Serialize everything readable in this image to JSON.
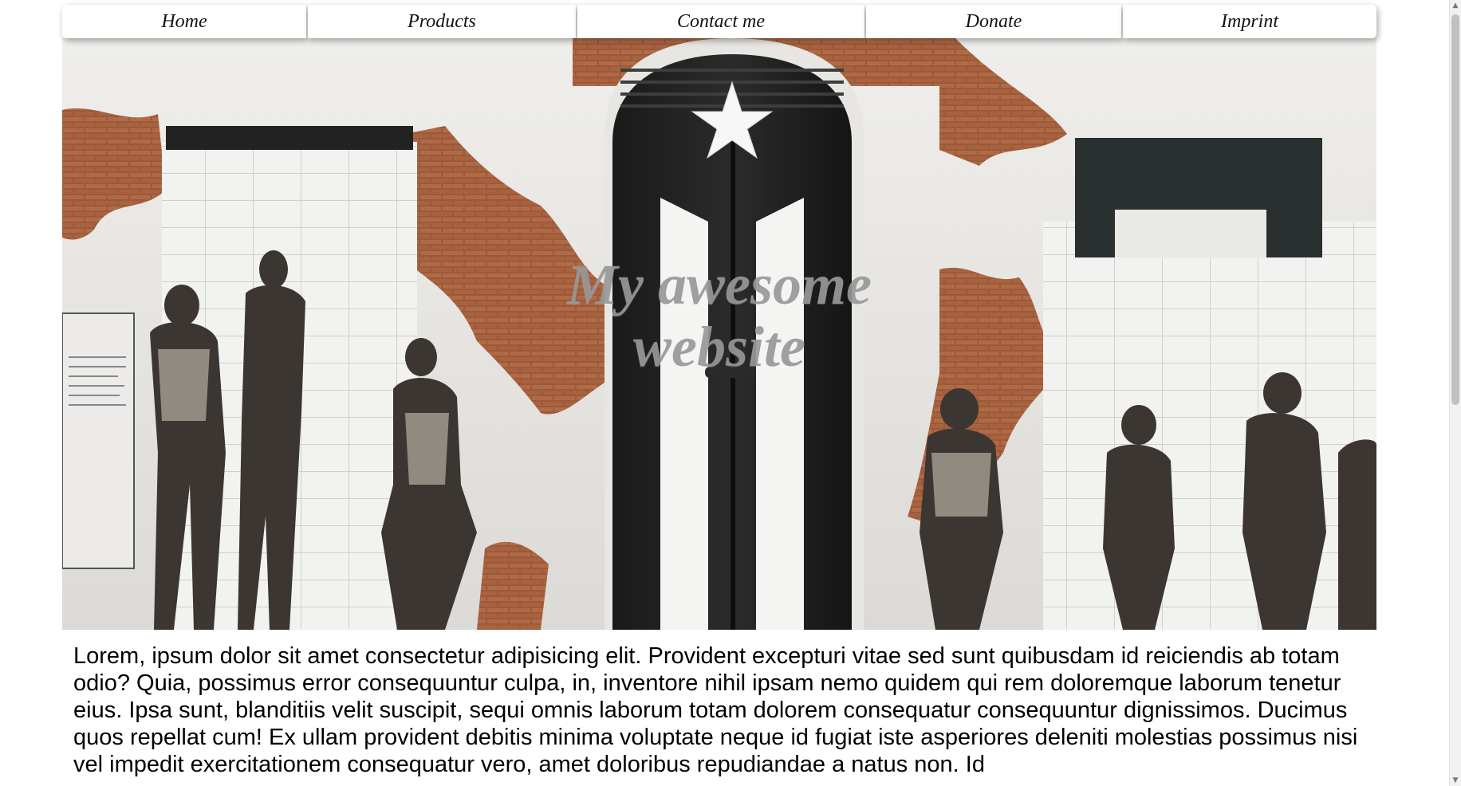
{
  "nav": {
    "items": [
      {
        "label": "Home"
      },
      {
        "label": "Products"
      },
      {
        "label": "Contact me"
      },
      {
        "label": "Donate"
      },
      {
        "label": "Imprint"
      }
    ]
  },
  "hero": {
    "title_line1": "My awesome",
    "title_line2": "website",
    "image_description_icon": "street-art-wall-image"
  },
  "content": {
    "paragraph": "Lorem, ipsum dolor sit amet consectetur adipisicing elit. Provident excepturi vitae sed sunt quibusdam id reiciendis ab totam odio? Quia, possimus error consequuntur culpa, in, inventore nihil ipsam nemo quidem qui rem doloremque laborum tenetur eius. Ipsa sunt, blanditiis velit suscipit, sequi omnis laborum totam dolorem consequatur consequuntur dignissimos. Ducimus quos repellat cum! Ex ullam provident debitis minima voluptate neque id fugiat iste asperiores deleniti molestias possimus nisi vel impedit exercitationem consequatur vero, amet doloribus repudiandae a natus non. Id"
  },
  "colors": {
    "nav_background": "#ffffff",
    "title_color": "#969696",
    "text_color": "#000000"
  },
  "scrollbar": {
    "up_arrow_icon": "scroll-up-icon",
    "down_arrow_icon": "scroll-down-icon"
  }
}
